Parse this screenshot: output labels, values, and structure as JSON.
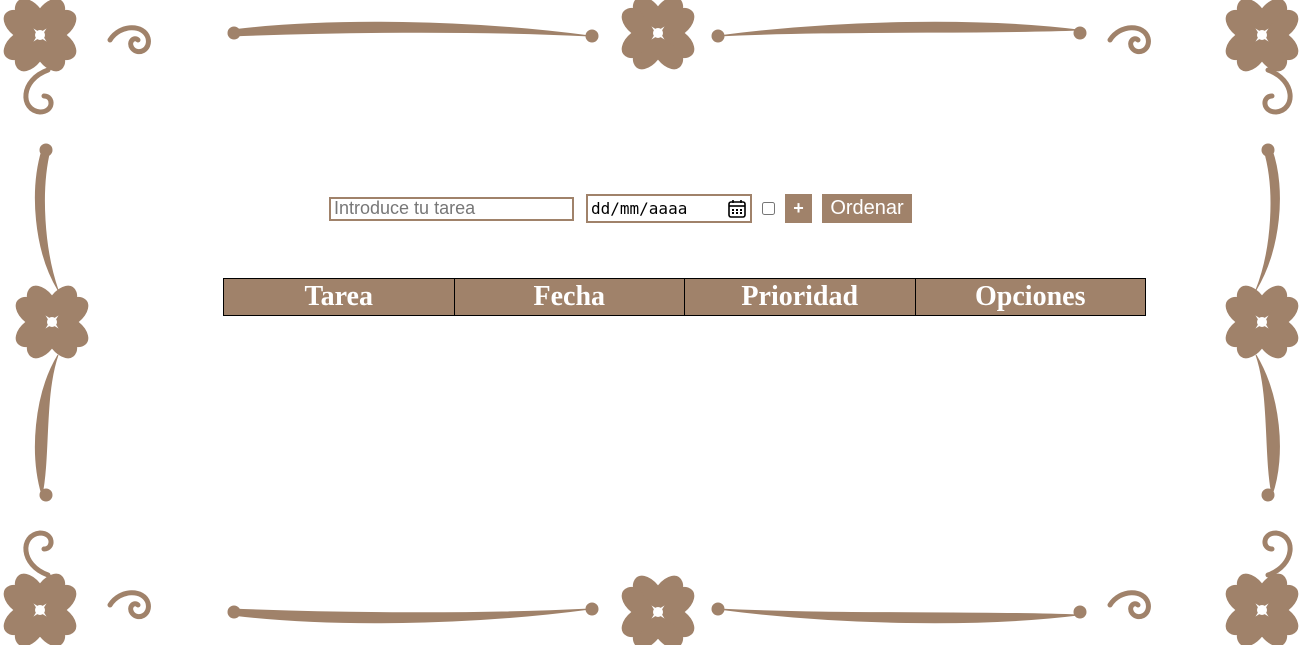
{
  "form": {
    "task_placeholder": "Introduce tu tarea",
    "date_value": "dd/mm/aaaa",
    "add_label": "+",
    "sort_label": "Ordenar"
  },
  "table": {
    "headers": [
      "Tarea",
      "Fecha",
      "Prioridad",
      "Opciones"
    ]
  },
  "theme": {
    "accent": "#a0826a",
    "border": "#000000",
    "background": "#ffffff"
  },
  "icons": [
    "calendar-icon",
    "heart-clover-ornament",
    "swirl-ornament"
  ]
}
